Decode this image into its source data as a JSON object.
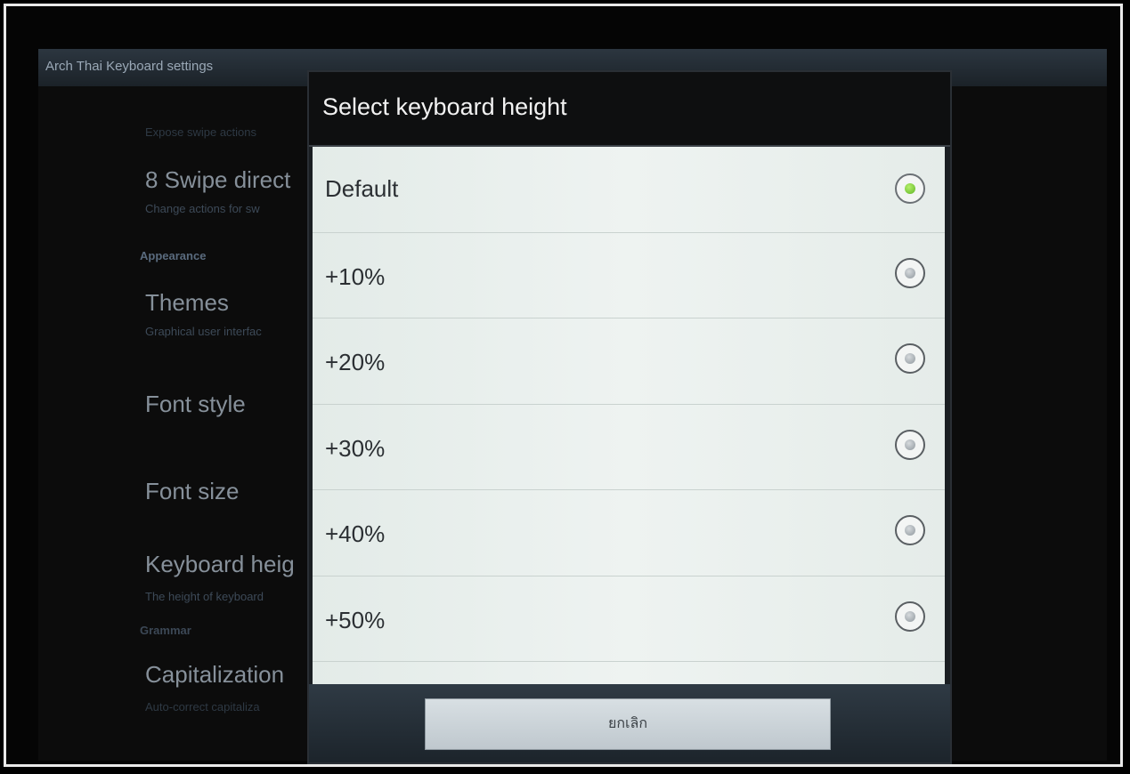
{
  "screen": {
    "title": "Arch Thai Keyboard settings"
  },
  "background_list": {
    "top_hint": "Expose swipe actions",
    "items": [
      {
        "title": "8 Swipe direct",
        "subtitle": "Change actions for sw"
      },
      {
        "category": "Appearance"
      },
      {
        "title": "Themes",
        "subtitle": "Graphical user interfac"
      },
      {
        "title": "Font style"
      },
      {
        "title": "Font size"
      },
      {
        "title": "Keyboard heig",
        "subtitle": "The height of keyboard"
      },
      {
        "category": "Grammar"
      },
      {
        "title": "Capitalization",
        "subtitle": "Auto-correct capitaliza"
      }
    ]
  },
  "dialog": {
    "title": "Select keyboard height",
    "options": [
      {
        "label": "Default",
        "selected": true
      },
      {
        "label": "+10%",
        "selected": false
      },
      {
        "label": "+20%",
        "selected": false
      },
      {
        "label": "+30%",
        "selected": false
      },
      {
        "label": "+40%",
        "selected": false
      },
      {
        "label": "+50%",
        "selected": false
      }
    ],
    "cancel_label": "ยกเลิก"
  },
  "colors": {
    "accent_selected": "#5eb524",
    "dialog_header": "#0e0f10",
    "list_background": "#eef3f1"
  }
}
